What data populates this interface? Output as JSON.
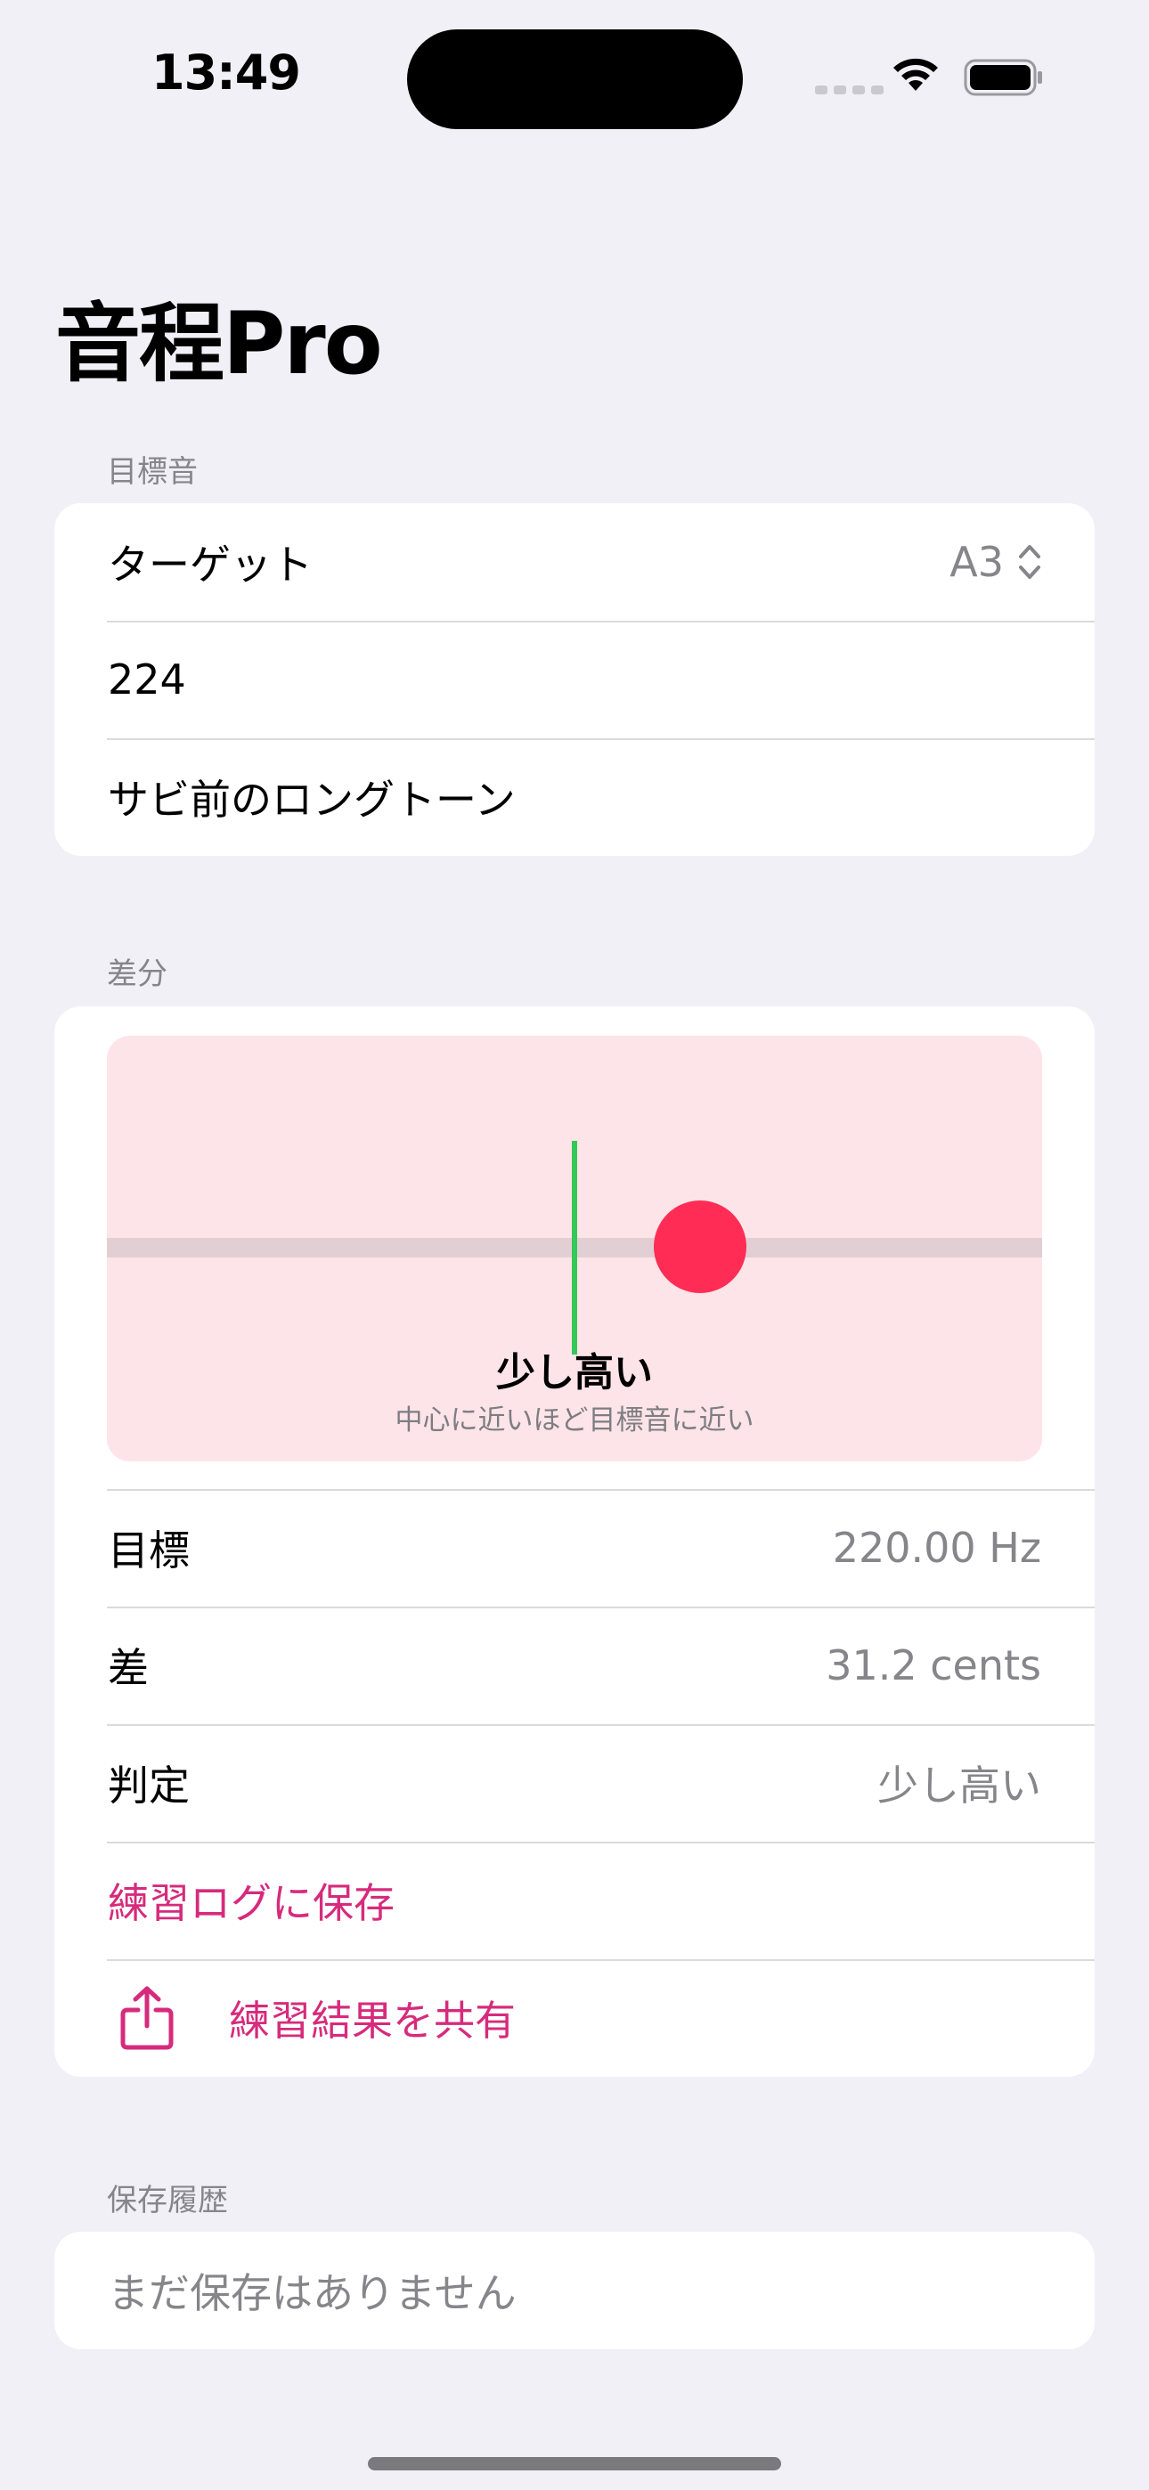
{
  "status": {
    "time": "13:49"
  },
  "title": "音程Pro",
  "target_section": {
    "header": "目標音",
    "target_label": "ターゲット",
    "target_value": "A3",
    "frequency_input": "224",
    "note_input": "サビ前のロングトーン"
  },
  "diff_section": {
    "header": "差分",
    "indicator_position": 0.312,
    "verdict_label": "少し高い",
    "hint": "中心に近いほど目標音に近い",
    "rows": [
      {
        "label": "目標",
        "value": "220.00 Hz"
      },
      {
        "label": "差",
        "value": "31.2 cents"
      },
      {
        "label": "判定",
        "value": "少し高い"
      }
    ],
    "save_label": "練習ログに保存",
    "share_label": "練習結果を共有"
  },
  "history_section": {
    "header": "保存履歴",
    "empty_text": "まだ保存はありません"
  },
  "colors": {
    "accent": "#d62b7c",
    "indicator": "#ff2d55",
    "center": "#34c759",
    "viz_bg": "#fde4e8"
  },
  "icons": [
    "wifi-icon",
    "battery-icon",
    "chevron-up-down-icon",
    "share-icon"
  ]
}
